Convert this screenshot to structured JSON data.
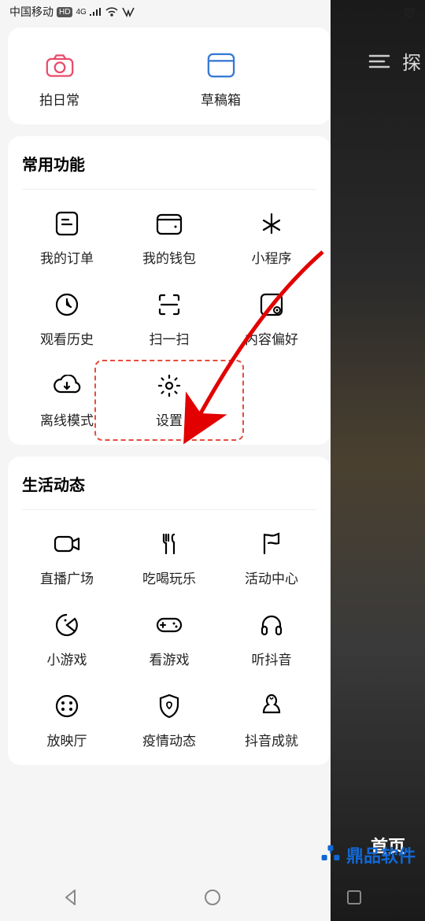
{
  "status": {
    "carrier": "中国移动",
    "hd": "HD",
    "4g": "4G",
    "alarm_icon": "alarm"
  },
  "bg": {
    "menu_icon": "menu",
    "explore": "探",
    "home": "首页"
  },
  "top_card": {
    "items": [
      {
        "label": "拍日常",
        "icon": "camera",
        "color": "#e94b6a"
      },
      {
        "label": "草稿箱",
        "icon": "drafts",
        "color": "#3a7bd5"
      }
    ]
  },
  "common": {
    "title": "常用功能",
    "items": [
      {
        "label": "我的订单",
        "icon": "order"
      },
      {
        "label": "我的钱包",
        "icon": "wallet"
      },
      {
        "label": "小程序",
        "icon": "miniapp"
      },
      {
        "label": "观看历史",
        "icon": "history"
      },
      {
        "label": "扫一扫",
        "icon": "scan"
      },
      {
        "label": "内容偏好",
        "icon": "preference"
      },
      {
        "label": "离线模式",
        "icon": "offline"
      },
      {
        "label": "设置",
        "icon": "settings"
      }
    ]
  },
  "life": {
    "title": "生活动态",
    "items": [
      {
        "label": "直播广场",
        "icon": "live"
      },
      {
        "label": "吃喝玩乐",
        "icon": "food"
      },
      {
        "label": "活动中心",
        "icon": "flag"
      },
      {
        "label": "小游戏",
        "icon": "pacman"
      },
      {
        "label": "看游戏",
        "icon": "gamepad"
      },
      {
        "label": "听抖音",
        "icon": "headphone"
      },
      {
        "label": "放映厅",
        "icon": "cinema"
      },
      {
        "label": "疫情动态",
        "icon": "shield"
      },
      {
        "label": "抖音成就",
        "icon": "achievement"
      }
    ]
  },
  "watermark": {
    "text": "鼎品软件"
  }
}
